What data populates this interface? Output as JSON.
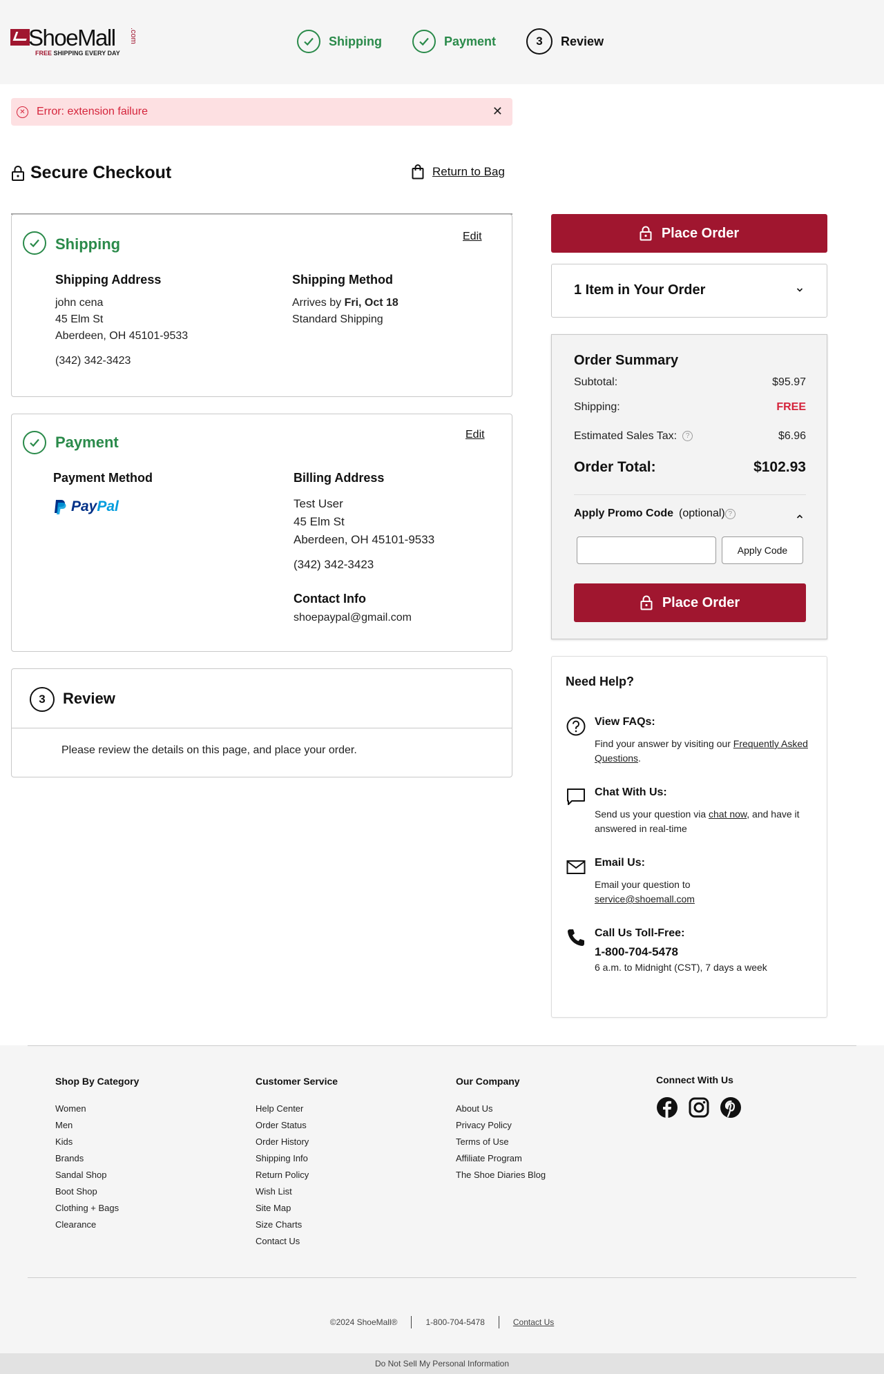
{
  "header": {
    "logo_brand": "ShoeMall",
    "logo_dotcom": ".com",
    "logo_tagline_free": "FREE",
    "logo_tagline_rest": " SHIPPING EVERY DAY",
    "steps": [
      {
        "label": "Shipping",
        "state": "done"
      },
      {
        "label": "Payment",
        "state": "done"
      },
      {
        "label": "Review",
        "number": "3",
        "state": "current"
      }
    ]
  },
  "error": {
    "message": "Error: extension failure",
    "close": "✕"
  },
  "checkout": {
    "title": "Secure Checkout",
    "return_label": "Return to Bag"
  },
  "shipping": {
    "title": "Shipping",
    "edit": "Edit",
    "address_heading": "Shipping Address",
    "name": "john cena",
    "street": "45 Elm St",
    "city": "Aberdeen, OH 45101-9533",
    "phone": "(342) 342-3423",
    "method_heading": "Shipping Method",
    "arrives_prefix": "Arrives by ",
    "arrives_date": "Fri, Oct 18",
    "method": "Standard Shipping"
  },
  "payment": {
    "title": "Payment",
    "edit": "Edit",
    "method_heading": "Payment Method",
    "method_logo_a": "Pay",
    "method_logo_b": "Pal",
    "billing_heading": "Billing Address",
    "billing_name": "Test User",
    "billing_street": "45 Elm St",
    "billing_city": "Aberdeen, OH 45101-9533",
    "billing_phone": "(342) 342-3423",
    "contact_heading": "Contact Info",
    "email": "shoepaypal@gmail.com"
  },
  "review": {
    "number": "3",
    "title": "Review",
    "text": "Please review the details on this page, and place your order."
  },
  "sidebar": {
    "place_order": "Place Order",
    "items_label": "1 Item in Your Order",
    "summary_title": "Order Summary",
    "subtotal_label": "Subtotal:",
    "subtotal_value": "$95.97",
    "shipping_label": "Shipping:",
    "shipping_value": "FREE",
    "tax_label": "Estimated Sales Tax:",
    "tax_value": "$6.96",
    "total_label": "Order Total:",
    "total_value": "$102.93",
    "promo_label": "Apply Promo Code",
    "promo_optional": "(optional)",
    "promo_placeholder": "",
    "apply_code": "Apply Code"
  },
  "help": {
    "title": "Need Help?",
    "faq_title": "View FAQs:",
    "faq_text": "Find your answer by visiting our ",
    "faq_link": "Frequently Asked Questions",
    "faq_end": ".",
    "chat_title": "Chat With Us:",
    "chat_text": "Send us your question via ",
    "chat_link": "chat now",
    "chat_end": ", and have it answered in real-time",
    "email_title": "Email Us:",
    "email_text": "Email your question to ",
    "email_link": "service@shoemall.com",
    "call_title": "Call Us Toll-Free:",
    "call_number": "1-800-704-5478",
    "call_hours": "6 a.m. to Midnight (CST), 7 days a week"
  },
  "footer": {
    "col1": {
      "heading": "Shop By Category",
      "links": [
        "Women",
        "Men",
        "Kids",
        "Brands",
        "Sandal Shop",
        "Boot Shop",
        "Clothing + Bags",
        "Clearance"
      ]
    },
    "col2": {
      "heading": "Customer Service",
      "links": [
        "Help Center",
        "Order Status",
        "Order History",
        "Shipping Info",
        "Return Policy",
        "Wish List",
        "Site Map",
        "Size Charts",
        "Contact Us"
      ]
    },
    "col3": {
      "heading": "Our Company",
      "links": [
        "About Us",
        "Privacy Policy",
        "Terms of Use",
        "Affiliate Program",
        "The Shoe Diaries Blog"
      ]
    },
    "col4": {
      "heading": "Connect With Us",
      "icons": [
        "facebook-icon",
        "instagram-icon",
        "pinterest-icon"
      ]
    },
    "copyright": "©2024 ShoeMall®",
    "phone": "1-800-704-5478",
    "contact": "Contact Us",
    "dns": "Do Not Sell My Personal Information"
  },
  "colors": {
    "brand": "#a0162f",
    "success": "#2a8a4a",
    "error": "#d5243b"
  }
}
